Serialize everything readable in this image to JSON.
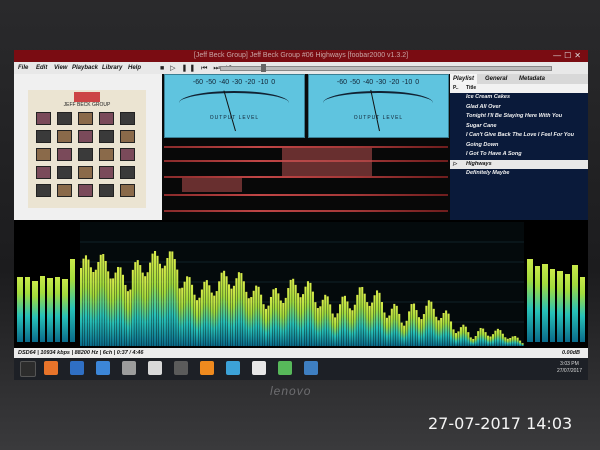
{
  "window": {
    "title": "[Jeff Beck Group] Jeff Beck Group #06 Highways [foobar2000 v1.3.2]"
  },
  "menu": {
    "file": "File",
    "edit": "Edit",
    "view": "View",
    "playback": "Playback",
    "library": "Library",
    "help": "Help"
  },
  "transport": {
    "glyphs": "■ ▷ ❚❚ ⏮ ⏭ ⤨"
  },
  "album": {
    "title": "JEFF BECK GROUP"
  },
  "vu": {
    "scale": "-60 -50 -40 -30 -20 -10  0",
    "unit_right": "dB",
    "label": "OUTPUT LEVEL"
  },
  "tabs": {
    "playlist": "Playlist",
    "general": "General",
    "metadata": "Metadata"
  },
  "playlist": {
    "col_playing": "P..",
    "col_title": "Title",
    "items": [
      {
        "title": "Ice Cream Cakes"
      },
      {
        "title": "Glad All Over"
      },
      {
        "title": "Tonight I'll Be Staying Here With You"
      },
      {
        "title": "Sugar Cane"
      },
      {
        "title": "I Can't Give Back The Love I Feel For You"
      },
      {
        "title": "Going Down"
      },
      {
        "title": "I Got To Have A Song"
      },
      {
        "title": "Highways"
      },
      {
        "title": "Definitely Maybe"
      }
    ],
    "playing_index": 7,
    "playing_marker": "▷"
  },
  "status": {
    "text": "DSD64 | 10934 kbps | 88200 Hz | 6ch | 0:37 / 4:46",
    "volume": "0.00dB"
  },
  "spectrum_colors": [
    "#0a6a8a",
    "#27c1b8",
    "#a3dc3c",
    "#d9ec4a"
  ],
  "peaks_left": [
    0.55,
    0.55,
    0.52,
    0.56,
    0.54,
    0.55,
    0.53,
    0.7
  ],
  "peaks_right": [
    0.7,
    0.64,
    0.66,
    0.62,
    0.6,
    0.58,
    0.65,
    0.55
  ],
  "taskbar": {
    "clock": "3:03 PM",
    "date": "27/07/2017"
  },
  "laptop": {
    "brand": "lenovo"
  },
  "photo_timestamp": "27-07-2017  14:03"
}
